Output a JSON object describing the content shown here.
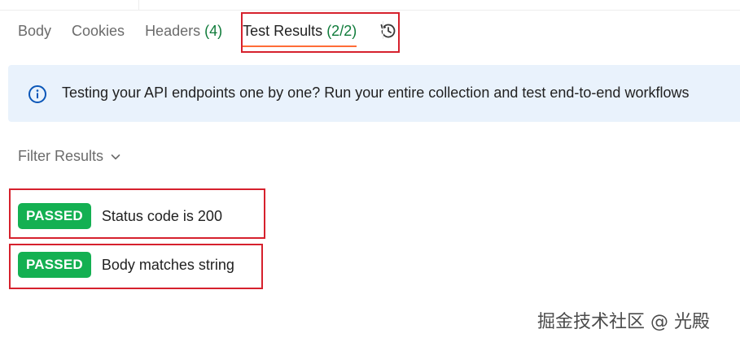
{
  "tabs": [
    {
      "label": "Body",
      "count": ""
    },
    {
      "label": "Cookies",
      "count": ""
    },
    {
      "label": "Headers",
      "count": "(4)"
    },
    {
      "label": "Test Results",
      "count": "(2/2)"
    }
  ],
  "banner": {
    "message": "Testing your API endpoints one by one? Run your entire collection and test end-to-end workflows"
  },
  "filter": {
    "label": "Filter Results"
  },
  "results": [
    {
      "status": "PASSED",
      "name": "Status code is 200"
    },
    {
      "status": "PASSED",
      "name": "Body matches string"
    }
  ],
  "watermark": "掘金技术社区 @ 光殿",
  "colors": {
    "passed": "#14b052",
    "count": "#0f7b3a",
    "highlight": "#d6212d",
    "active_underline": "#ff6c37",
    "banner_bg": "#e9f2fc"
  }
}
